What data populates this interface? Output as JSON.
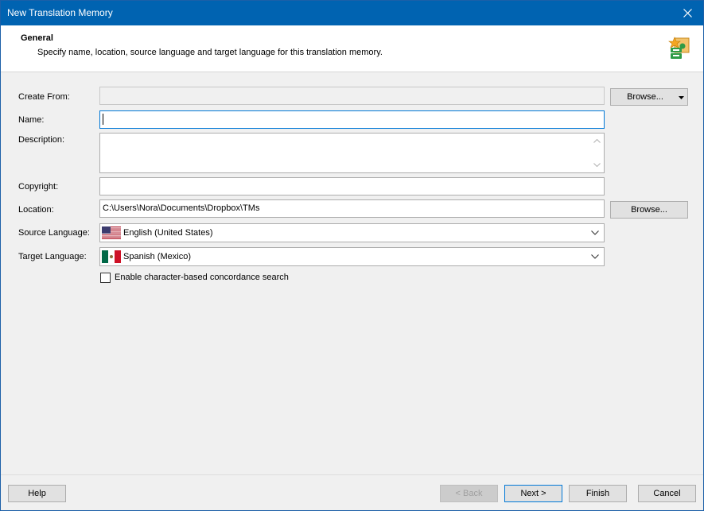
{
  "window": {
    "title": "New Translation Memory"
  },
  "header": {
    "title": "General",
    "description": "Specify name, location, source language and target language for this translation memory."
  },
  "form": {
    "create_from": {
      "label": "Create From:",
      "value": ""
    },
    "name": {
      "label": "Name:",
      "value": ""
    },
    "description": {
      "label": "Description:",
      "value": ""
    },
    "copyright": {
      "label": "Copyright:",
      "value": ""
    },
    "location": {
      "label": "Location:",
      "value": "C:\\Users\\Nora\\Documents\\Dropbox\\TMs"
    },
    "source_language": {
      "label": "Source Language:",
      "value": "English (United States)"
    },
    "target_language": {
      "label": "Target Language:",
      "value": "Spanish (Mexico)"
    },
    "concordance_checkbox": {
      "label": "Enable character-based concordance search",
      "checked": false
    },
    "browse_create_label": "Browse...",
    "browse_location_label": "Browse..."
  },
  "footer": {
    "help": "Help",
    "back": "< Back",
    "next": "Next >",
    "finish": "Finish",
    "cancel": "Cancel"
  },
  "colors": {
    "titlebar": "#0063b1",
    "accent": "#0078d7"
  }
}
